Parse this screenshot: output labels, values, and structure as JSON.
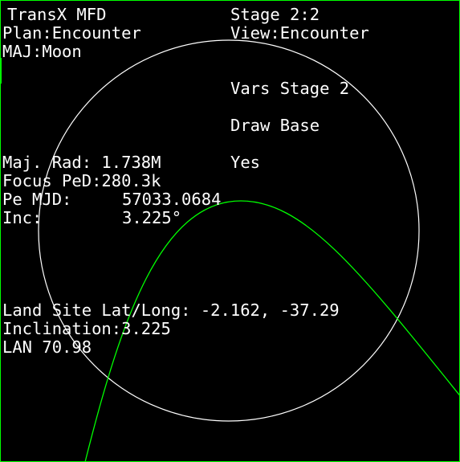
{
  "header": {
    "title": "TransX MFD",
    "stage": "Stage 2:2",
    "plan": "Plan:Encounter",
    "view": "View:Encounter",
    "major_body": "MAJ:Moon"
  },
  "menu": {
    "vars_stage": "Vars Stage 2",
    "draw_base_label": "Draw Base",
    "draw_base_value": "Yes"
  },
  "orbit_info": {
    "maj_rad": "Maj. Rad: 1.738M",
    "focus_ped": "Focus PeD:280.3k",
    "pe_mjd_label": "Pe MJD:",
    "pe_mjd_value": "57033.0684",
    "inc_label": "Inc:",
    "inc_value": "3.225°"
  },
  "landing": {
    "land_site": "Land Site Lat/Long: -2.162, -37.29",
    "inclination": "Inclination:3.225",
    "lan": "LAN 70.98"
  },
  "colors": {
    "background": "#000000",
    "text": "#ffffff",
    "trajectory": "#00ff00",
    "planet_outline": "#ffffff",
    "border": "#00ff00"
  }
}
